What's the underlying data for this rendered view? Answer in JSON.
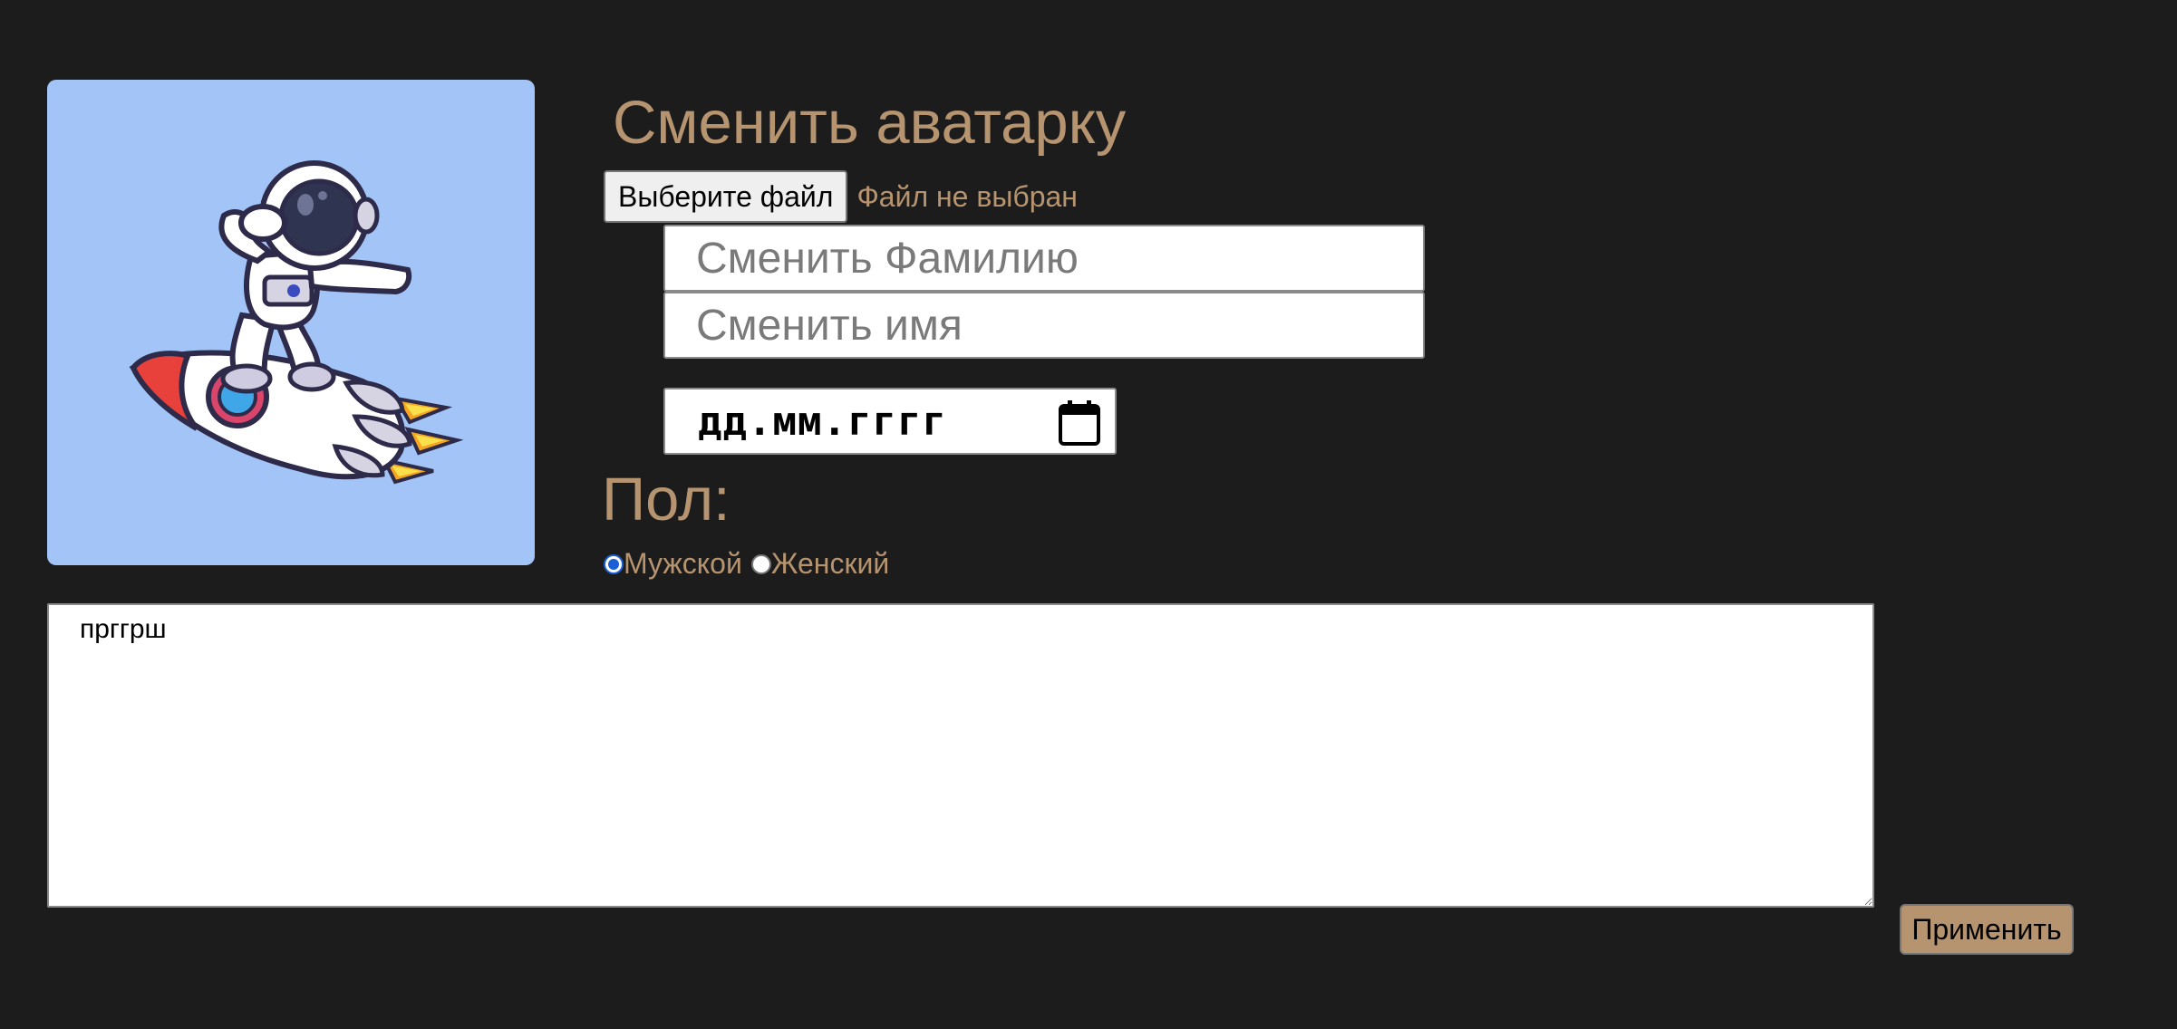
{
  "avatar": {
    "description_icon": "astronaut-on-rocket-image",
    "background_color": "#a2c4f7"
  },
  "profile_form": {
    "title": "Сменить аватарку",
    "file_button_label": "Выберите файл",
    "file_status": "Файл не выбран",
    "lastname_placeholder": "Сменить Фамилию",
    "firstname_placeholder": "Сменить имя",
    "date_placeholder": "дд.мм.гггг",
    "gender_label": "Пол:",
    "gender_options": [
      {
        "label": "Мужской",
        "checked": true
      },
      {
        "label": "Женский",
        "checked": false
      }
    ],
    "bio_value": "прггрш",
    "apply_label": "Применить"
  },
  "colors": {
    "page_background": "#1c1c1c",
    "accent": "#b79470",
    "radio_selected": "#1a5fd6"
  }
}
